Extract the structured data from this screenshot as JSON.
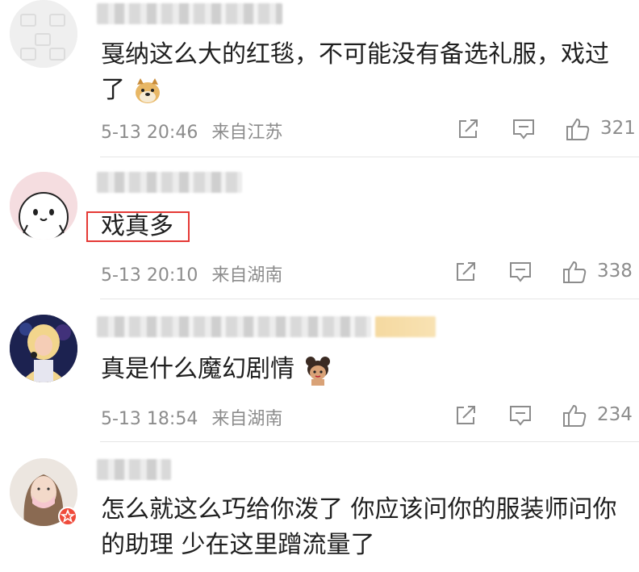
{
  "comments": [
    {
      "text_line1": "戛纳这么大的红毯，不可能没有备选礼服，戏过",
      "text_line2": "了",
      "emoji": "doge-emoji",
      "time": "5-13 20:46",
      "location": "来自江苏",
      "likes": "321"
    },
    {
      "text_line1": "戏真多",
      "time": "5-13 20:10",
      "location": "来自湖南",
      "likes": "338"
    },
    {
      "text_line1": "真是什么魔幻剧情",
      "emoji": "cartoon-girl-emoji",
      "time": "5-13 18:54",
      "location": "来自湖南",
      "likes": "234"
    },
    {
      "text_line1": "怎么就这么巧给你泼了 你应该问你的服装师问你",
      "text_line2": "的助理 少在这里蹭流量了"
    }
  ],
  "icons": {
    "share": "share-icon",
    "comment": "comment-icon",
    "like": "thumbs-up-icon"
  },
  "colors": {
    "highlight": "#e53935",
    "meta": "#8c8c8c",
    "badge": "#ef4b3b"
  }
}
